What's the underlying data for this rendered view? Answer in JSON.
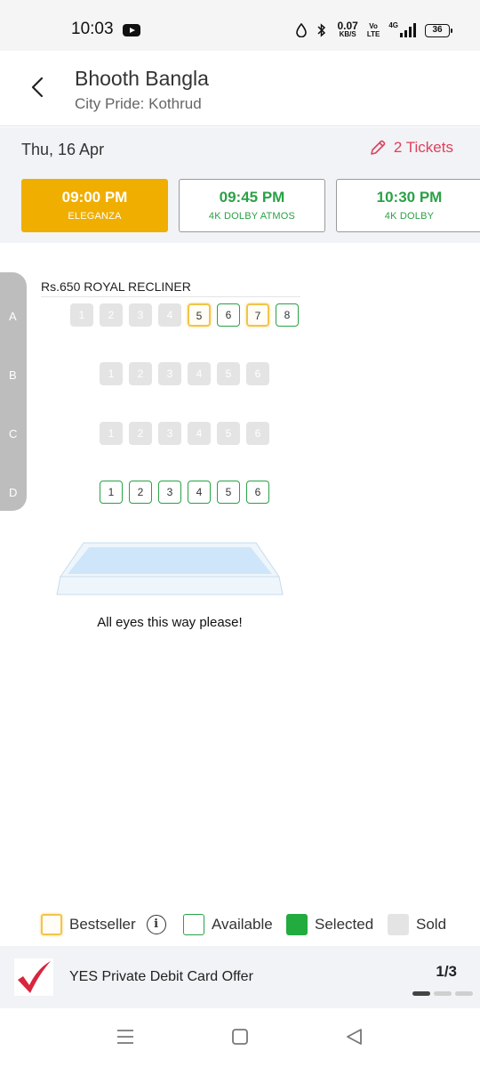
{
  "status_bar": {
    "time": "10:03",
    "net_speed_value": "0.07",
    "net_speed_unit": "KB/S",
    "volte_top": "Vo",
    "volte_bottom": "LTE",
    "network_type": "4G",
    "battery_level": "36"
  },
  "header": {
    "movie_title": "Bhooth Bangla",
    "cinema": "City Pride: Kothrud"
  },
  "booking": {
    "date": "Thu, 16 Apr",
    "tickets_label": "2 Tickets"
  },
  "showtimes": [
    {
      "time": "09:00 PM",
      "format": "ELEGANZA",
      "selected": true
    },
    {
      "time": "09:45 PM",
      "format": "4K DOLBY ATMOS",
      "selected": false
    },
    {
      "time": "10:30 PM",
      "format": "4K DOLBY",
      "selected": false
    }
  ],
  "seat_layout": {
    "category": "Rs.650  ROYAL RECLINER",
    "rows": [
      {
        "label": "A",
        "seats": [
          {
            "num": "1",
            "status": "sold"
          },
          {
            "num": "2",
            "status": "sold"
          },
          {
            "num": "3",
            "status": "sold"
          },
          {
            "num": "4",
            "status": "sold"
          },
          {
            "num": "5",
            "status": "bestseller"
          },
          {
            "num": "6",
            "status": "available"
          },
          {
            "num": "7",
            "status": "bestseller"
          },
          {
            "num": "8",
            "status": "available"
          }
        ]
      },
      {
        "label": "B",
        "seats": [
          {
            "num": "1",
            "status": "sold"
          },
          {
            "num": "2",
            "status": "sold"
          },
          {
            "num": "3",
            "status": "sold"
          },
          {
            "num": "4",
            "status": "sold"
          },
          {
            "num": "5",
            "status": "sold"
          },
          {
            "num": "6",
            "status": "sold"
          }
        ]
      },
      {
        "label": "C",
        "seats": [
          {
            "num": "1",
            "status": "sold"
          },
          {
            "num": "2",
            "status": "sold"
          },
          {
            "num": "3",
            "status": "sold"
          },
          {
            "num": "4",
            "status": "sold"
          },
          {
            "num": "5",
            "status": "sold"
          },
          {
            "num": "6",
            "status": "sold"
          }
        ]
      },
      {
        "label": "D",
        "seats": [
          {
            "num": "1",
            "status": "available"
          },
          {
            "num": "2",
            "status": "available"
          },
          {
            "num": "3",
            "status": "available"
          },
          {
            "num": "4",
            "status": "available"
          },
          {
            "num": "5",
            "status": "available"
          },
          {
            "num": "6",
            "status": "available"
          }
        ]
      }
    ],
    "screen_caption": "All eyes this way please!"
  },
  "legend": {
    "bestseller": "Bestseller",
    "info_glyph": "i",
    "available": "Available",
    "selected": "Selected",
    "sold": "Sold"
  },
  "offer": {
    "text": "YES Private Debit Card Offer",
    "page_indicator": "1/3"
  },
  "colors": {
    "accent_yellow": "#f0ae00",
    "available_green": "#2aa146",
    "selected_green": "#22ab3f",
    "tickets_red": "#e0405c",
    "sold_gray": "#e4e4e4"
  }
}
